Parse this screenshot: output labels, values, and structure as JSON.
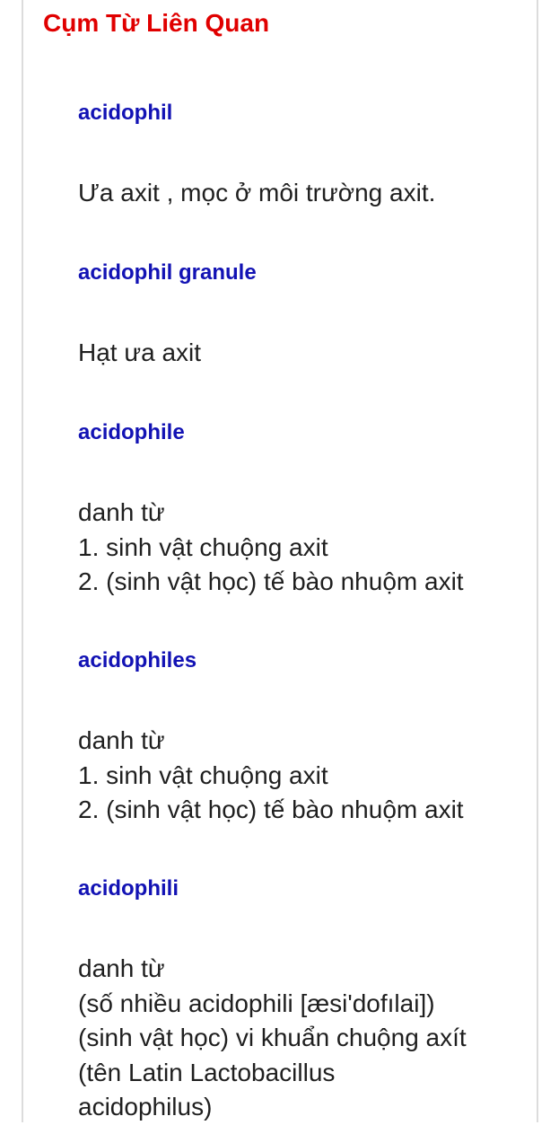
{
  "section": {
    "title": "Cụm Từ Liên Quan"
  },
  "entries": [
    {
      "term": "acidophil",
      "definition": [
        "Ưa axit , mọc ở môi trường axit."
      ]
    },
    {
      "term": "acidophil granule",
      "definition": [
        "Hạt ưa axit"
      ]
    },
    {
      "term": "acidophile",
      "definition": [
        "danh từ",
        "1. sinh vật chuộng axit",
        "2. (sinh vật học) tế bào nhuộm axit"
      ]
    },
    {
      "term": "acidophiles",
      "definition": [
        "danh từ",
        "1. sinh vật chuộng axit",
        "2. (sinh vật học) tế bào nhuộm axit"
      ]
    },
    {
      "term": "acidophili",
      "definition": [
        "danh từ",
        "(số nhiều acidophili [æsi'dofılai])",
        "(sinh vật học) vi khuẩn chuộng axít",
        "(tên Latin Lactobacillus",
        "acidophilus)"
      ]
    }
  ]
}
